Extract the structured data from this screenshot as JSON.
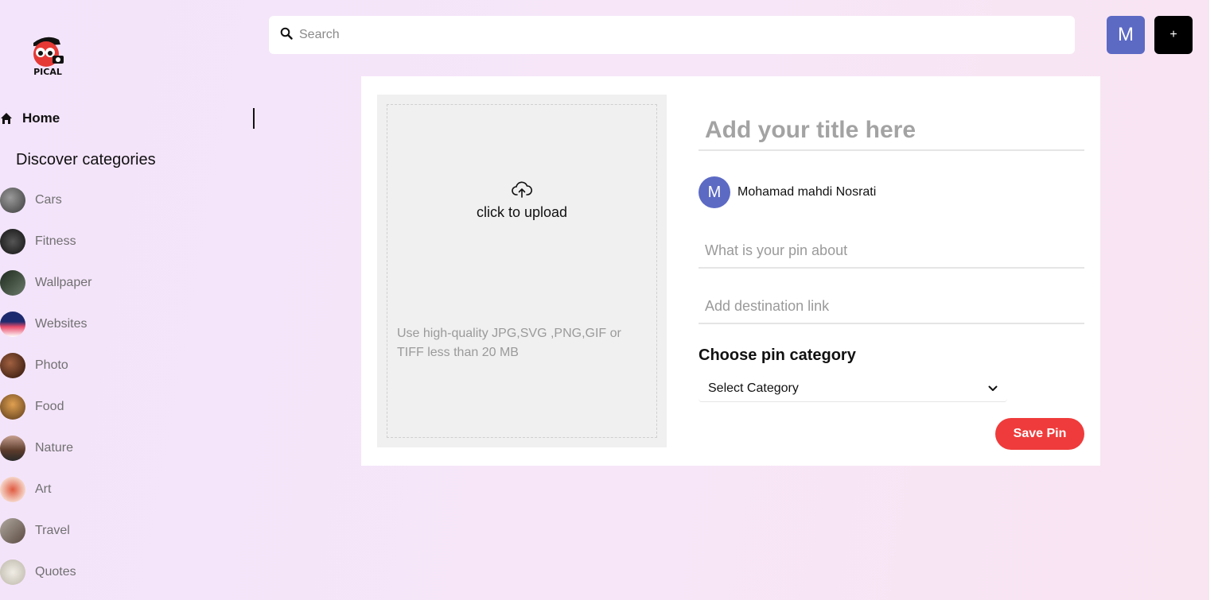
{
  "brand": {
    "logo_text": "PICAL"
  },
  "sidebar": {
    "home_label": "Home",
    "discover_title": "Discover categories",
    "categories": [
      {
        "label": "Cars",
        "thumb_color": "#5a5a5a"
      },
      {
        "label": "Fitness",
        "thumb_color": "#2b2b2b"
      },
      {
        "label": "Wallpaper",
        "thumb_color": "#3d4a3d"
      },
      {
        "label": "Websites",
        "thumb_color": "#2a3f8f"
      },
      {
        "label": "Photo",
        "thumb_color": "#5a3320"
      },
      {
        "label": "Food",
        "thumb_color": "#b07a3a"
      },
      {
        "label": "Nature",
        "thumb_color": "#7a5a45"
      },
      {
        "label": "Art",
        "thumb_color": "#c9473a"
      },
      {
        "label": "Travel",
        "thumb_color": "#8a7a70"
      },
      {
        "label": "Quotes",
        "thumb_color": "#d8d4cc"
      }
    ]
  },
  "header": {
    "search_placeholder": "Search",
    "avatar_initial": "M",
    "add_label": "+"
  },
  "upload": {
    "cta": "click to upload",
    "hint": "Use high-quality JPG,SVG ,PNG,GIF or TIFF less than 20 MB"
  },
  "form": {
    "title_placeholder": "Add your title here",
    "author_initial": "M",
    "author_name": "Mohamad mahdi Nosrati",
    "about_placeholder": "What is your pin about",
    "link_placeholder": "Add destination link",
    "category_heading": "Choose pin category",
    "category_selected": "Select Category",
    "save_label": "Save Pin"
  },
  "colors": {
    "accent": "#5c6ac4",
    "save": "#ef3b3b"
  }
}
